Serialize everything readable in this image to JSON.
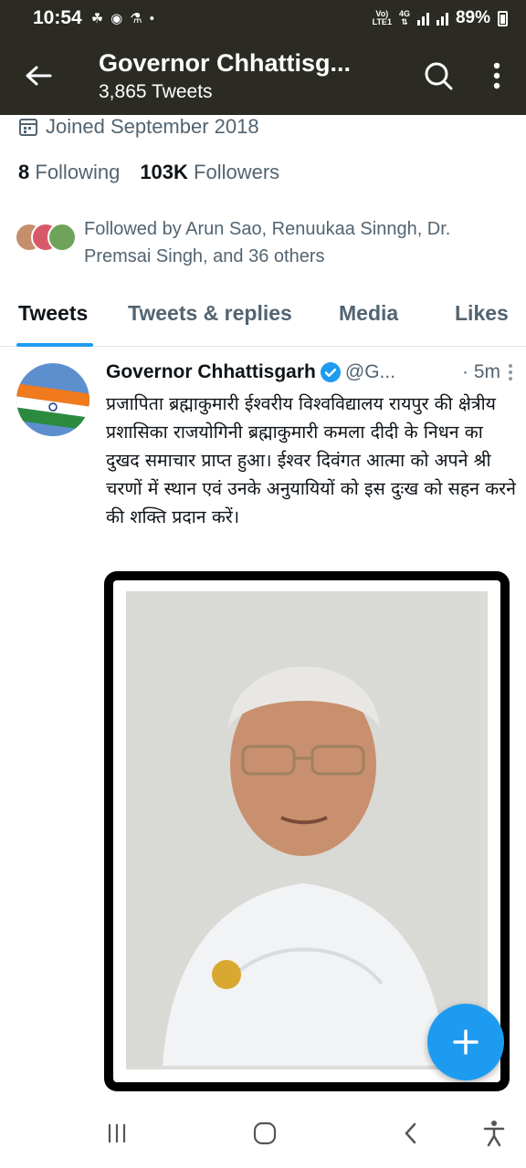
{
  "status_bar": {
    "time": "10:54",
    "network_label": "Vo) 4G LTE1",
    "battery": "89%"
  },
  "header": {
    "title": "Governor Chhattisg...",
    "subtitle": "3,865 Tweets"
  },
  "profile": {
    "joined": "Joined September 2018",
    "following_count": "8",
    "following_label": "Following",
    "followers_count": "103K",
    "followers_label": "Followers",
    "followed_by": "Followed by Arun Sao, Renuukaa Sinngh, Dr. Premsai Singh, and 36 others"
  },
  "tabs": [
    {
      "label": "Tweets",
      "active": true
    },
    {
      "label": "Tweets & replies",
      "active": false
    },
    {
      "label": "Media",
      "active": false
    },
    {
      "label": "Likes",
      "active": false
    }
  ],
  "tweet": {
    "author": "Governor Chhattisgarh",
    "handle": "@G...",
    "time": "· 5m",
    "text": "प्रजापिता ब्रह्माकुमारी ईश्वरीय विश्वविद्यालय रायपुर की क्षेत्रीय प्रशासिका राजयोगिनी ब्रह्माकुमारी कमला दीदी के निधन का दुखद समाचार प्राप्त हुआ। ईश्वर दिवंगत आत्मा को अपने श्री चरणों में स्थान एवं उनके अनुयायियों को इस दुःख को सहन करने की शक्ति प्रदान करें।"
  },
  "colors": {
    "header_bg": "#2b2b24",
    "accent": "#1d9bf0",
    "secondary_text": "#536471"
  }
}
